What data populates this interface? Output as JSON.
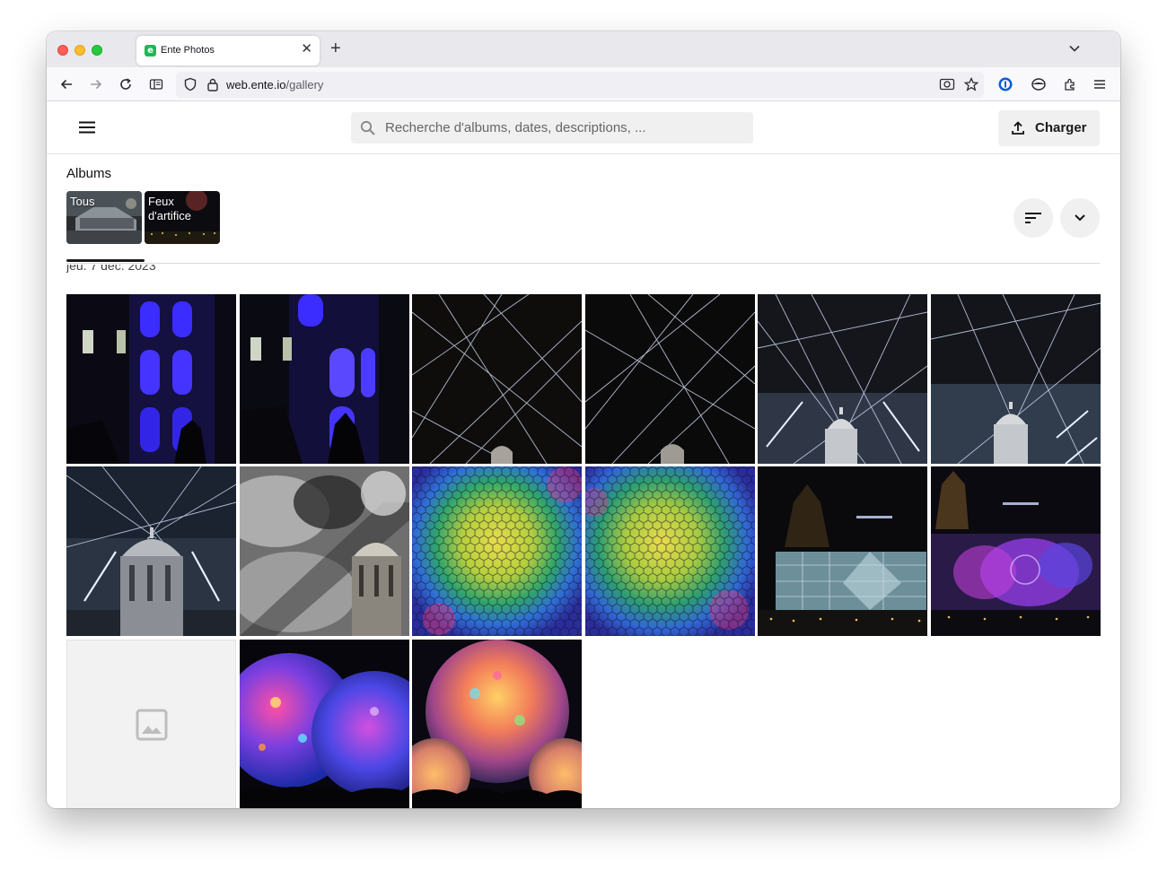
{
  "browser": {
    "tab_title": "Ente Photos",
    "favicon_letter": "e",
    "url_domain": "web.ente.io",
    "url_path": "/gallery"
  },
  "app": {
    "search_placeholder": "Recherche d'albums, dates, descriptions, ...",
    "upload_label": "Charger"
  },
  "albums": {
    "title": "Albums",
    "items": [
      {
        "label": "Tous",
        "selected": true
      },
      {
        "label": "Feux d'artifice",
        "selected": false
      }
    ]
  },
  "gallery": {
    "date_header_partial": "jeu. 7 déc. 2023",
    "photos": [
      {
        "name": "photo-blue-lanterns-1"
      },
      {
        "name": "photo-blue-lanterns-2"
      },
      {
        "name": "photo-lasers-1"
      },
      {
        "name": "photo-lasers-2"
      },
      {
        "name": "photo-lasers-dome-1"
      },
      {
        "name": "photo-lasers-dome-2"
      },
      {
        "name": "photo-dome-lasers-3"
      },
      {
        "name": "photo-dome-smoke"
      },
      {
        "name": "photo-hexagon-mosaic-1"
      },
      {
        "name": "photo-hexagon-mosaic-2"
      },
      {
        "name": "photo-building-projection"
      },
      {
        "name": "photo-purple-projection"
      },
      {
        "name": "photo-placeholder"
      },
      {
        "name": "photo-balloons-1"
      },
      {
        "name": "photo-balloons-2"
      }
    ]
  },
  "colors": {
    "accent": "#1db954",
    "lantern_blue": "#3b2cff",
    "laser_white": "#d8e4ff"
  }
}
